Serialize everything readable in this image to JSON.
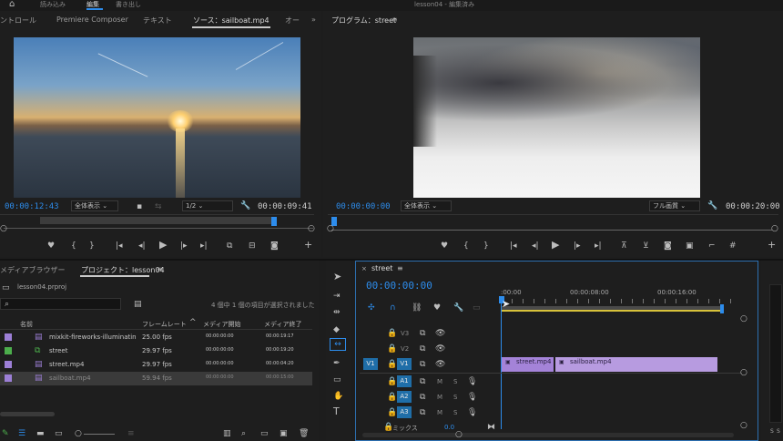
{
  "app": {
    "top_tabs": [
      "読み込み",
      "編集",
      "書き出し"
    ],
    "window_title": "lesson04 - 編集済み"
  },
  "source_panel": {
    "tabs": [
      "ントロール",
      "Premiere Composer",
      "テキスト",
      "ソース：sailboat.mp4",
      "オー"
    ],
    "active_tab": "ソース：sailboat.mp4",
    "timecode_in": "00:00:12:43",
    "timecode_dur": "00:00:09:41",
    "fit_label": "全体表示",
    "resolution": "1/2"
  },
  "program_panel": {
    "title": "プログラム：street",
    "timecode_in": "00:00:00:00",
    "timecode_dur": "00:00:20:00",
    "fit_label": "全体表示",
    "quality": "フル画質"
  },
  "project_panel": {
    "tabs": [
      "メディアブラウザー",
      "プロジェクト：lesson04"
    ],
    "active_tab": "プロジェクト：lesson04",
    "project_file": "lesson04.prproj",
    "search_placeholder": "",
    "selection_status": "4 個中 1 個の項目が選択されました",
    "columns": [
      "名前",
      "フレームレート",
      "メディア開始",
      "メディア終了"
    ],
    "items": [
      {
        "name": "mixkit-fireworks-illuminatin",
        "fps": "25.00 fps",
        "start": "00:00:00:00",
        "end": "00:00:19:17",
        "color": "#9c7fd6"
      },
      {
        "name": "street",
        "fps": "29.97 fps",
        "start": "00:00:00:00",
        "end": "00:00:19:20",
        "color": "#4cae4c"
      },
      {
        "name": "street.mp4",
        "fps": "29.97 fps",
        "start": "00:00:00:00",
        "end": "00:00:04:20",
        "color": "#9c7fd6"
      },
      {
        "name": "sailboat.mp4",
        "fps": "59.94 fps",
        "start": "00:00:00:00",
        "end": "00:00:15:00",
        "color": "#9c7fd6"
      }
    ]
  },
  "timeline": {
    "tab": "street",
    "timecode": "00:00:00:00",
    "ruler": [
      ":00:00",
      "00:00:08:00",
      "00:00:16:00"
    ],
    "video_tracks": [
      "V3",
      "V2",
      "V1"
    ],
    "audio_tracks": [
      "A1",
      "A2",
      "A3"
    ],
    "mix_label": "ミックス",
    "mix_value": "0.0",
    "clips": [
      {
        "name": "street.mp4",
        "track": "V1"
      },
      {
        "name": "sailboat.mp4",
        "track": "V1"
      }
    ],
    "v1_source": "V1"
  },
  "meter": {
    "labels": [
      "S",
      "S"
    ]
  },
  "colors": {
    "accent": "#2d8ceb",
    "clip": "#a483d8",
    "track_btn": "#1f6ea8"
  }
}
